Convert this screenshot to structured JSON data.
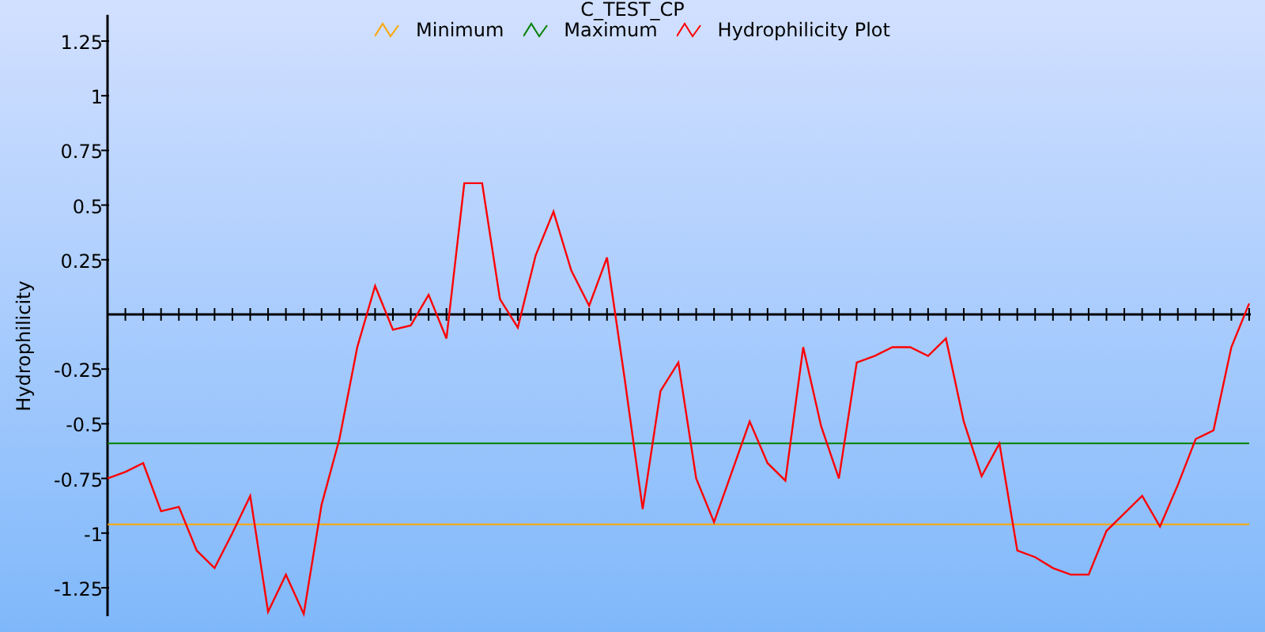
{
  "chart": {
    "chart_data": {
      "type": "line",
      "title": "C_TEST_CP",
      "ylabel": "Hydrophilicity",
      "ylim": [
        -1.38,
        1.37
      ],
      "yticks": [
        {
          "value": 1.25,
          "label": "1.25"
        },
        {
          "value": 1,
          "label": "1"
        },
        {
          "value": 0.75,
          "label": "0.75"
        },
        {
          "value": 0.5,
          "label": "0.5"
        },
        {
          "value": 0.25,
          "label": "0.25"
        },
        {
          "value": -0.25,
          "label": "-0.25"
        },
        {
          "value": -0.5,
          "label": "-0.5"
        },
        {
          "value": -0.75,
          "label": "-0.75"
        },
        {
          "value": -1,
          "label": "-1"
        },
        {
          "value": -1.25,
          "label": "-1.25"
        }
      ],
      "series": [
        {
          "name": "Minimum",
          "color": "#ffa500",
          "values": [
            -0.96,
            -0.96,
            -0.96,
            -0.96,
            -0.96,
            -0.96,
            -0.96,
            -0.96,
            -0.96,
            -0.96,
            -0.96,
            -0.96,
            -0.96,
            -0.96,
            -0.96,
            -0.96,
            -0.96,
            -0.96,
            -0.96,
            -0.96,
            -0.96,
            -0.96,
            -0.96,
            -0.96,
            -0.96,
            -0.96,
            -0.96,
            -0.96,
            -0.96,
            -0.96,
            -0.96,
            -0.96,
            -0.96,
            -0.96,
            -0.96,
            -0.96,
            -0.96,
            -0.96,
            -0.96,
            -0.96,
            -0.96,
            -0.96,
            -0.96,
            -0.96,
            -0.96,
            -0.96,
            -0.96,
            -0.96,
            -0.96,
            -0.96,
            -0.96,
            -0.96,
            -0.96,
            -0.96,
            -0.96,
            -0.96,
            -0.96,
            -0.96,
            -0.96,
            -0.96,
            -0.96,
            -0.96,
            -0.96,
            -0.96,
            -0.96
          ]
        },
        {
          "name": "Maximum",
          "color": "#008000",
          "values": [
            -0.59,
            -0.59,
            -0.59,
            -0.59,
            -0.59,
            -0.59,
            -0.59,
            -0.59,
            -0.59,
            -0.59,
            -0.59,
            -0.59,
            -0.59,
            -0.59,
            -0.59,
            -0.59,
            -0.59,
            -0.59,
            -0.59,
            -0.59,
            -0.59,
            -0.59,
            -0.59,
            -0.59,
            -0.59,
            -0.59,
            -0.59,
            -0.59,
            -0.59,
            -0.59,
            -0.59,
            -0.59,
            -0.59,
            -0.59,
            -0.59,
            -0.59,
            -0.59,
            -0.59,
            -0.59,
            -0.59,
            -0.59,
            -0.59,
            -0.59,
            -0.59,
            -0.59,
            -0.59,
            -0.59,
            -0.59,
            -0.59,
            -0.59,
            -0.59,
            -0.59,
            -0.59,
            -0.59,
            -0.59,
            -0.59,
            -0.59,
            -0.59,
            -0.59,
            -0.59,
            -0.59,
            -0.59,
            -0.59,
            -0.59,
            -0.59
          ]
        },
        {
          "name": "Hydrophilicity Plot",
          "color": "#ff0000",
          "values": [
            -0.75,
            -0.72,
            -0.68,
            -0.9,
            -0.88,
            -1.08,
            -1.16,
            -1.0,
            -0.83,
            -1.36,
            -1.19,
            -1.37,
            -0.87,
            -0.57,
            -0.15,
            0.13,
            -0.07,
            -0.05,
            0.09,
            -0.11,
            0.6,
            0.6,
            0.07,
            -0.06,
            0.27,
            0.47,
            0.2,
            0.04,
            0.26,
            -0.3,
            -0.89,
            -0.35,
            -0.22,
            -0.75,
            -0.95,
            -0.72,
            -0.49,
            -0.68,
            -0.76,
            -0.15,
            -0.51,
            -0.75,
            -0.22,
            -0.19,
            -0.15,
            -0.15,
            -0.19,
            -0.11,
            -0.49,
            -0.74,
            -0.59,
            -1.08,
            -1.11,
            -1.16,
            -1.19,
            -1.19,
            -0.99,
            -0.91,
            -0.83,
            -0.97,
            -0.78,
            -0.57,
            -0.53,
            -0.15,
            0.05
          ]
        }
      ]
    }
  }
}
